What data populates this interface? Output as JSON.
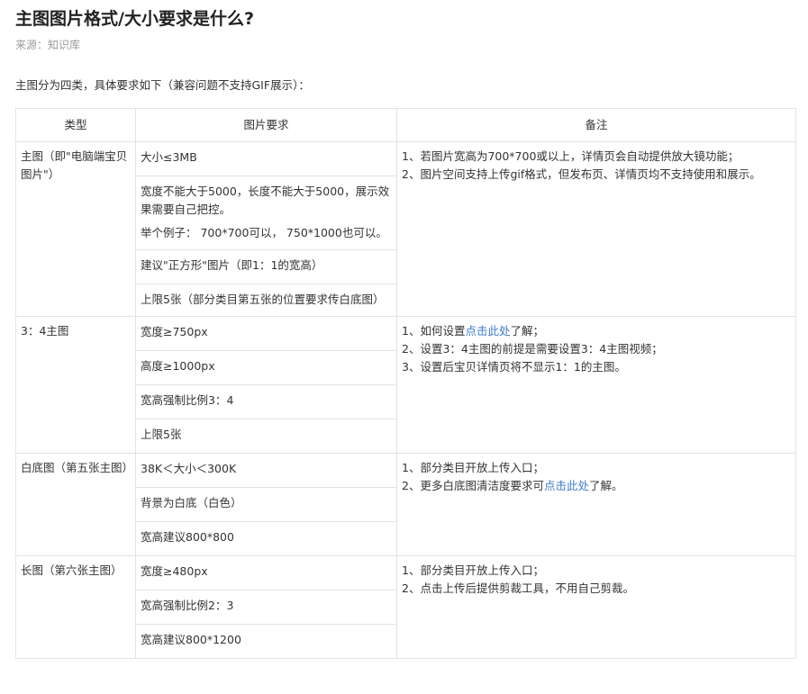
{
  "article": {
    "title": "主图图片格式/大小要求是什么?",
    "source": "来源：知识库",
    "intro": "主图分为四类，具体要求如下（兼容问题不支持GIF展示）："
  },
  "table": {
    "headers": [
      "类型",
      "图片要求",
      "备注"
    ],
    "groups": [
      {
        "category": "主图（即\"电脑端宝贝图片\"）",
        "requirements": [
          "大小≤3MB",
          "宽度不能大于5000，长度不能大于5000，展示效果需要自己把控。",
          "举个例子： 700*700可以， 750*1000也可以。",
          "建议\"正方形\"图片（即1：1的宽高）",
          "上限5张（部分类目第五张的位置要求传白底图）"
        ],
        "notes": [
          "1、若图片宽高为700*700或以上，详情页会自动提供放大镜功能；",
          "2、图片空间支持上传gif格式，但发布页、详情页均不支持使用和展示。"
        ]
      },
      {
        "category": "3：4主图",
        "requirements": [
          "宽度≥750px",
          "高度≥1000px",
          "宽高强制比例3：4",
          "上限5张"
        ],
        "notes": [
          {
            "pre": "1、如何设置",
            "link": "点击此处",
            "post": "了解；"
          },
          "2、设置3：4主图的前提是需要设置3：4主图视频；",
          "3、设置后宝贝详情页将不显示1：1的主图。"
        ]
      },
      {
        "category": "白底图（第五张主图）",
        "requirements": [
          "38K＜大小＜300K",
          "背景为白底（白色）",
          "宽高建议800*800"
        ],
        "notes": [
          "1、部分类目开放上传入口；",
          {
            "pre": "2、更多白底图清洁度要求可",
            "link": "点击此处",
            "post": "了解。"
          }
        ]
      },
      {
        "category": "长图（第六张主图）",
        "requirements": [
          "宽度≥480px",
          "宽高强制比例2：3",
          "宽高建议800*1200"
        ],
        "notes": [
          "1、部分类目开放上传入口；",
          "2、点击上传后提供剪裁工具，不用自己剪裁。"
        ]
      }
    ]
  }
}
